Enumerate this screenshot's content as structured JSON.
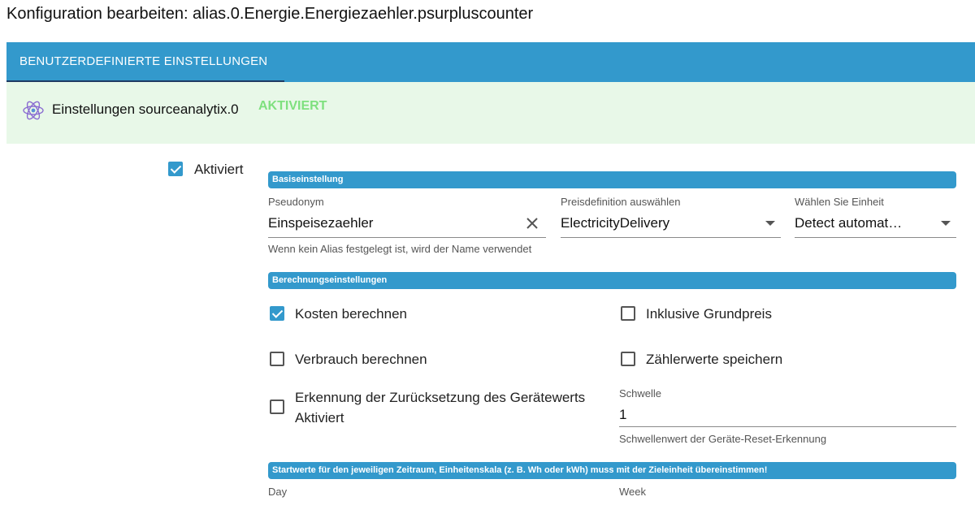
{
  "header": {
    "title": "Konfiguration bearbeiten: alias.0.Energie.Energiezaehler.psurpluscounter"
  },
  "tabs": [
    {
      "label": "BENUTZERDEFINIERTE EINSTELLUNGEN",
      "active": true
    }
  ],
  "adapter": {
    "label": "Einstellungen sourceanalytix.0",
    "status": "AKTIVIERT",
    "icon": "atom-icon"
  },
  "enabled": {
    "label": "Aktiviert",
    "checked": true
  },
  "basic": {
    "header": "Basiseinstellung",
    "pseudonym": {
      "label": "Pseudonym",
      "value": "Einspeisezaehler",
      "helper": "Wenn kein Alias festgelegt ist, wird der Name verwendet"
    },
    "price": {
      "label": "Preisdefinition auswählen",
      "value": "ElectricityDelivery"
    },
    "unit": {
      "label": "Wählen Sie Einheit",
      "value": "Detect automat…"
    }
  },
  "calc": {
    "header": "Berechnungseinstellungen",
    "costs": {
      "label": "Kosten berechnen",
      "checked": true
    },
    "base_price": {
      "label": "Inklusive Grundpreis",
      "checked": false
    },
    "consumption": {
      "label": "Verbrauch berechnen",
      "checked": false
    },
    "meter_values": {
      "label": "Zählerwerte speichern",
      "checked": false
    },
    "reset_detection": {
      "label_line1": "Erkennung der Zurücksetzung des Gerätewerts",
      "label_line2": "Aktiviert",
      "checked": false
    },
    "threshold": {
      "label": "Schwelle",
      "value": "1",
      "helper": "Schwellenwert der Geräte-Reset-Erkennung"
    }
  },
  "start_values": {
    "header": "Startwerte für den jeweiligen Zeitraum, Einheitenskala (z. B. Wh oder kWh) muss mit der Zieleinheit übereinstimmen!",
    "day_label": "Day",
    "week_label": "Week"
  },
  "colors": {
    "accent": "#3399cc",
    "status_bg": "#e8f8e8",
    "status_text": "#7ee07e",
    "tab_indicator": "#1f3b63"
  }
}
